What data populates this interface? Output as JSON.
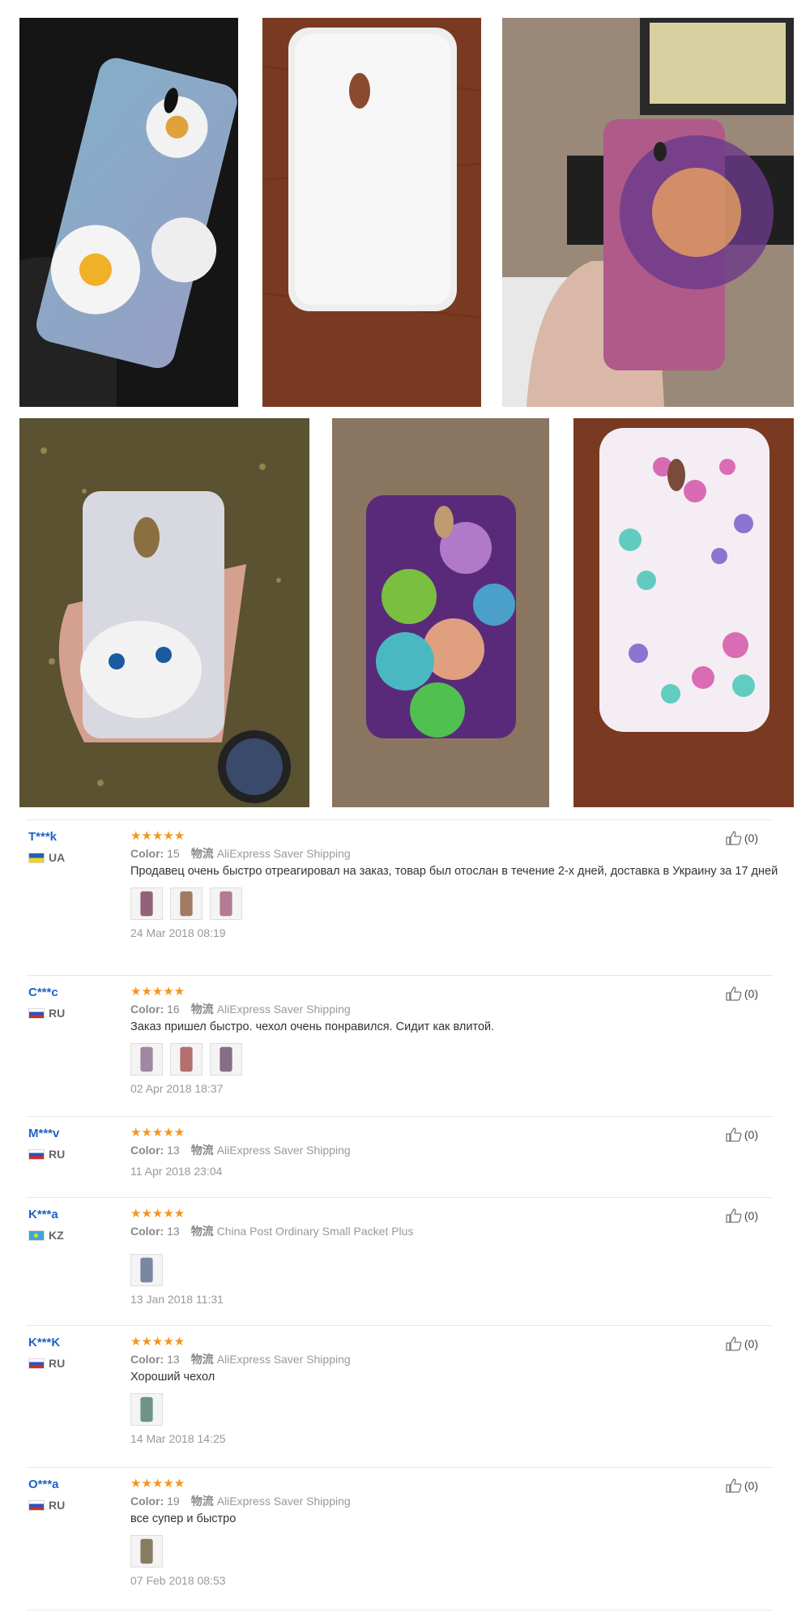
{
  "photos": [
    {
      "name": "photo-daisy-case",
      "theme": "daisy"
    },
    {
      "name": "photo-clear-case",
      "theme": "clear"
    },
    {
      "name": "photo-mandala-case",
      "theme": "mandala"
    },
    {
      "name": "photo-kitten-case",
      "theme": "kitten"
    },
    {
      "name": "photo-smiley-case",
      "theme": "smiley"
    },
    {
      "name": "photo-leaves-case",
      "theme": "leaves"
    }
  ],
  "review_labels": {
    "color": "Color:",
    "shipping": "物流"
  },
  "reviews": [
    {
      "user": "T***k",
      "country": "UA",
      "flag": "ua",
      "color": "15",
      "shipping": "AliExpress Saver Shipping",
      "text": "Продавец очень быстро отреагировал на заказ, товар был отослан в течение 2-х дней, доставка в Украину за 17 дней",
      "thumbs": [
        "#7a3a5a",
        "#8a5a3a",
        "#a05a7a"
      ],
      "date": "24 Mar 2018 08:19",
      "likes": "(0)"
    },
    {
      "user": "C***c",
      "country": "RU",
      "flag": "ru",
      "color": "16",
      "shipping": "AliExpress Saver Shipping",
      "text": "Заказ пришел быстро. чехол очень понравился. Сидит как влитой.",
      "thumbs": [
        "#8a6a8a",
        "#a04a4a",
        "#6a4a6a"
      ],
      "date": "02 Apr 2018 18:37",
      "likes": "(0)"
    },
    {
      "user": "M***v",
      "country": "RU",
      "flag": "ru",
      "color": "13",
      "shipping": "AliExpress Saver Shipping",
      "text": "",
      "thumbs": [],
      "date": "11 Apr 2018 23:04",
      "likes": "(0)"
    },
    {
      "user": "K***a",
      "country": "KZ",
      "flag": "kz",
      "color": "13",
      "shipping": "China Post Ordinary Small Packet Plus",
      "text": "",
      "thumbs": [
        "#5a6a8a"
      ],
      "date": "13 Jan 2018 11:31",
      "likes": "(0)"
    },
    {
      "user": "K***K",
      "country": "RU",
      "flag": "ru",
      "color": "13",
      "shipping": "AliExpress Saver Shipping",
      "text": "Хороший чехол",
      "thumbs": [
        "#4a7a6a"
      ],
      "date": "14 Mar 2018 14:25",
      "likes": "(0)"
    },
    {
      "user": "O***a",
      "country": "RU",
      "flag": "ru",
      "color": "19",
      "shipping": "AliExpress Saver Shipping",
      "text": "все супер и быстро",
      "thumbs": [
        "#6a5a3a"
      ],
      "date": "07 Feb 2018 08:53",
      "likes": "(0)"
    }
  ]
}
